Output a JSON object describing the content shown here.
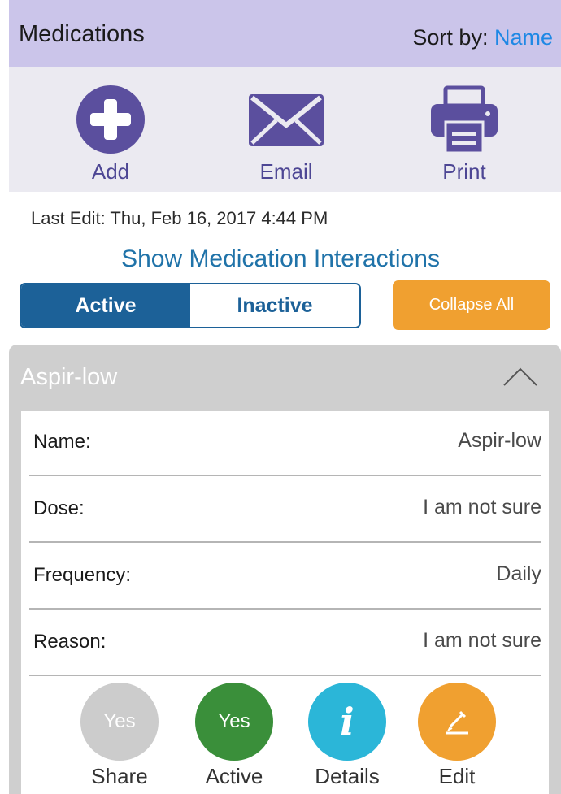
{
  "header": {
    "title": "Medications",
    "sort_label": "Sort by:",
    "sort_value": "Name"
  },
  "toolbar": {
    "add_label": "Add",
    "add_icon": "plus-circle-icon",
    "email_label": "Email",
    "email_icon": "envelope-icon",
    "print_label": "Print",
    "print_icon": "printer-icon",
    "icon_color": "#5b4f9e"
  },
  "last_edit": "Last Edit: Thu, Feb 16, 2017  4:44 PM",
  "interactions_link": "Show Medication Interactions",
  "filter": {
    "active": "Active",
    "inactive": "Inactive",
    "selected": "Active"
  },
  "collapse_label": "Collapse All",
  "medication": {
    "title": "Aspir-low",
    "fields": [
      {
        "key": "Name:",
        "value": "Aspir-low"
      },
      {
        "key": "Dose:",
        "value": "I am not sure"
      },
      {
        "key": "Frequency:",
        "value": "Daily"
      },
      {
        "key": "Reason:",
        "value": "I am not sure"
      }
    ],
    "actions": [
      {
        "badge": "Yes",
        "label": "Share",
        "color": "#cccccc"
      },
      {
        "badge": "Yes",
        "label": "Active",
        "color": "#3a8f3a"
      },
      {
        "badge": "i",
        "label": "Details",
        "color": "#2bb6d8"
      },
      {
        "badge": "pencil-icon",
        "label": "Edit",
        "color": "#f0a030"
      }
    ]
  }
}
